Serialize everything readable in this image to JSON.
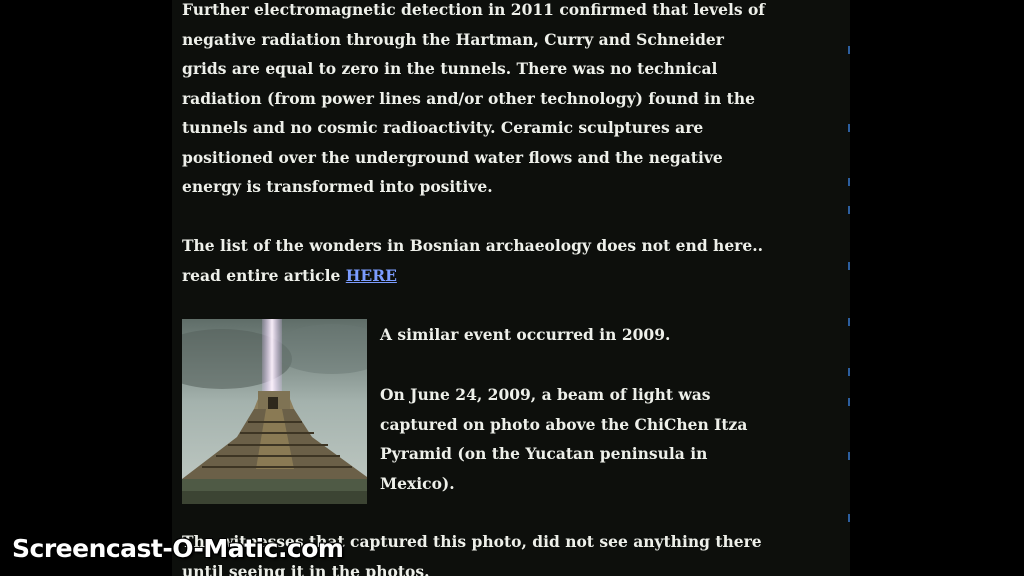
{
  "article": {
    "paragraph1": [
      "Further electromagnetic detection in 2011 confirmed that levels of",
      "negative radiation through the Hartman, Curry and Schneider",
      "grids are equal to zero in the tunnels. There was no technical",
      "radiation (from power lines and/or other technology) found in the",
      "tunnels and no cosmic radioactivity. Ceramic sculptures are",
      "positioned over the underground water flows and the negative",
      "energy is transformed into positive."
    ],
    "paragraph2": {
      "line1": "The list of the wonders in Bosnian archaeology does not end here..",
      "line2_prefix": "read entire article ",
      "link_text": "HERE"
    },
    "paragraph3": "A similar event occurred in 2009.",
    "paragraph4": [
      "On June 24, 2009, a beam of light was",
      "captured on photo above the ChiChen Itza",
      "Pyramid (on the Yucatan peninsula in",
      "Mexico)."
    ],
    "paragraph5": [
      "The witnesses that captured this photo, did not see anything there",
      "until seeing it in the photos."
    ]
  },
  "image": {
    "subject": "pyramid-with-light-beam"
  },
  "watermark": {
    "text": "Screencast-O-Matic.com"
  },
  "colors": {
    "background": "#000000",
    "column": "#0d0f0c",
    "text": "#eef0ea",
    "link": "#7b9cff",
    "scroll_ticks": "#2c5e9e"
  }
}
